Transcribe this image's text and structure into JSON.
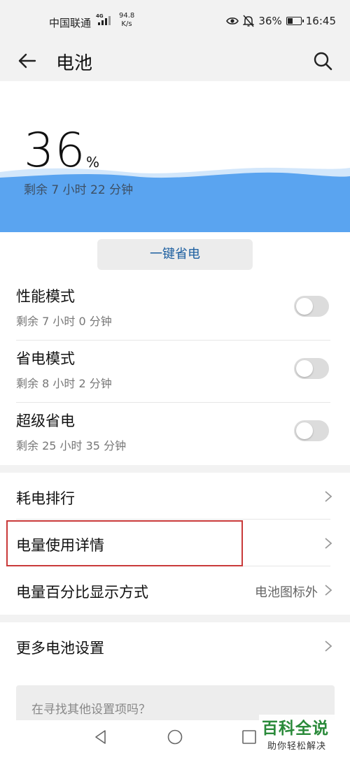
{
  "status_bar": {
    "carrier": "中国联通",
    "network_type": "4G",
    "speed_value": "94.8",
    "speed_unit": "K/s",
    "battery_percent": "36%",
    "time": "16:45",
    "icons": [
      "eye-icon",
      "mute-bell-icon",
      "battery-icon"
    ]
  },
  "app_bar": {
    "title": "电池",
    "back_icon": "arrow-left-icon",
    "search_icon": "search-icon"
  },
  "hero": {
    "percent_value": "36",
    "percent_sign": "%",
    "remaining": "剩余 7 小时 22 分钟",
    "wave_color": "#5aa4f0",
    "wave_light_color": "#d3e7fb",
    "level": 0.36
  },
  "power_save_button": "一键省电",
  "modes": [
    {
      "title": "性能模式",
      "subtitle": "剩余 7 小时 0 分钟",
      "enabled": false
    },
    {
      "title": "省电模式",
      "subtitle": "剩余 8 小时 2 分钟",
      "enabled": false
    },
    {
      "title": "超级省电",
      "subtitle": "剩余 25 小时 35 分钟",
      "enabled": false
    }
  ],
  "list": [
    {
      "title": "耗电排行",
      "value": ""
    },
    {
      "title": "电量使用详情",
      "value": ""
    },
    {
      "title": "电量百分比显示方式",
      "value": "电池图标外"
    }
  ],
  "more": {
    "title": "更多电池设置"
  },
  "search": {
    "placeholder": "在寻找其他设置项吗？"
  },
  "watermark": {
    "title": "百科全说",
    "subtitle": "助你轻松解决"
  },
  "colors": {
    "accent_text": "#1d5fa0",
    "highlight_border": "#c93a3a",
    "watermark_green": "#2a8a3a"
  }
}
